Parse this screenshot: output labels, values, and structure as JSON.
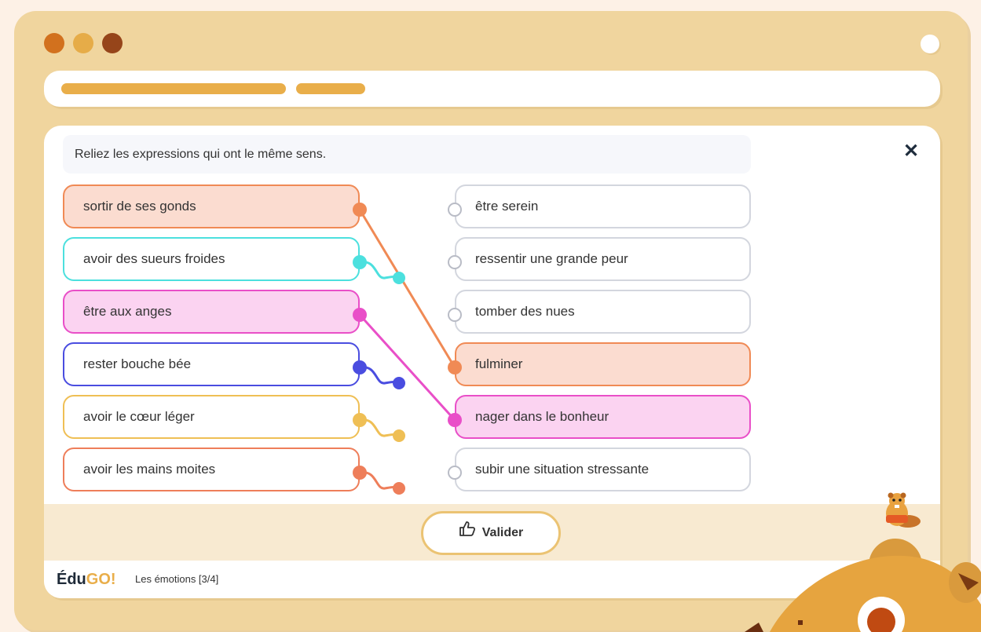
{
  "instruction": "Reliez les expressions qui ont le même sens.",
  "left_items": [
    {
      "label": "sortir de ses gonds",
      "color": "#f08a55",
      "fill": "#fbdcd0",
      "matched": true
    },
    {
      "label": "avoir des sueurs froides",
      "color": "#4ce0de",
      "fill": "#ffffff",
      "matched": false
    },
    {
      "label": "être aux anges",
      "color": "#e94fc8",
      "fill": "#fbd3f1",
      "matched": true
    },
    {
      "label": "rester bouche bée",
      "color": "#4a4de0",
      "fill": "#ffffff",
      "matched": false
    },
    {
      "label": "avoir le cœur léger",
      "color": "#efbf55",
      "fill": "#ffffff",
      "matched": false
    },
    {
      "label": "avoir les mains moites",
      "color": "#ee7e5a",
      "fill": "#ffffff",
      "matched": false
    }
  ],
  "right_items": [
    {
      "label": "être serein",
      "matched": false
    },
    {
      "label": "ressentir une grande peur",
      "matched": false
    },
    {
      "label": "tomber des nues",
      "matched": false
    },
    {
      "label": "fulminer",
      "matched": true
    },
    {
      "label": "nager dans le bonheur",
      "matched": true
    },
    {
      "label": "subir une situation stressante",
      "matched": false
    }
  ],
  "connections": [
    {
      "from": 0,
      "to": 3
    },
    {
      "from": 2,
      "to": 4
    }
  ],
  "validate_label": "Valider",
  "footer": {
    "logo_text": "ÉduGO!",
    "logo_main": "Édu",
    "logo_accent": "GO!",
    "lesson": "Les émotions [3/4]"
  },
  "icons": {
    "close": "close-icon",
    "validate": "thumbs-up-icon",
    "mascot": "beaver-icon"
  },
  "colors": {
    "window": "#f0d59e",
    "accent": "#e9ae4a",
    "traffic_light_1": "#d2711e",
    "traffic_light_2": "#e6ac48",
    "traffic_light_3": "#96451a"
  }
}
